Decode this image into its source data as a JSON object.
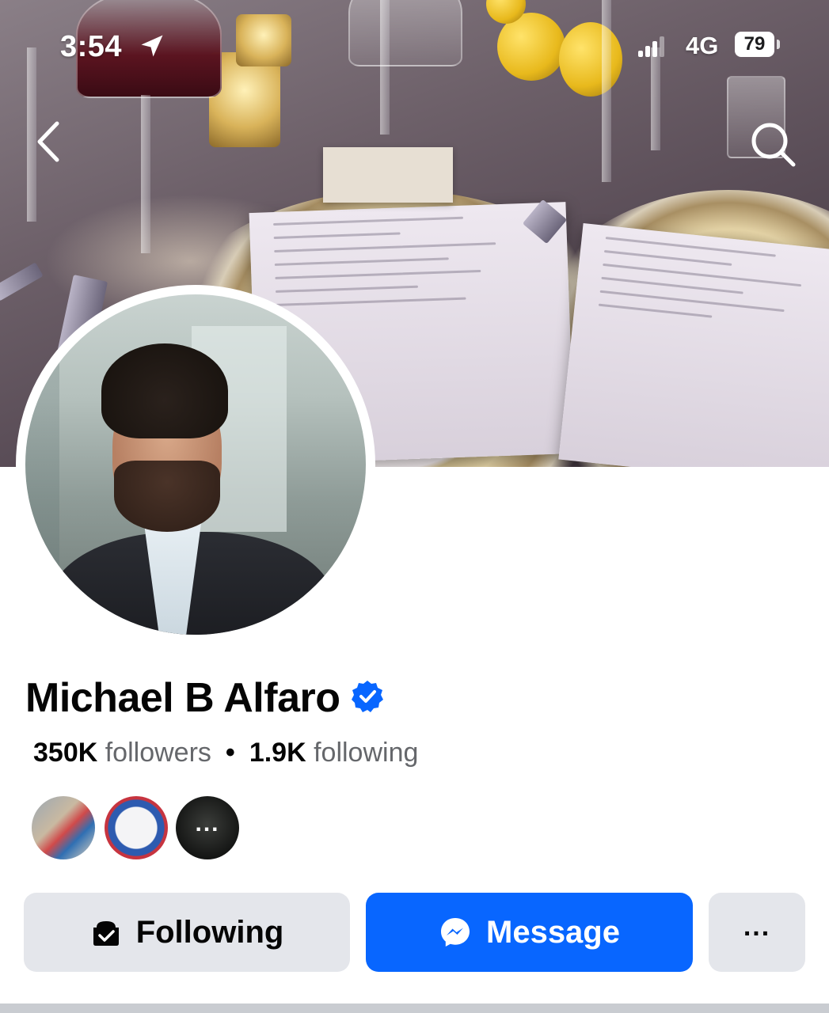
{
  "status_bar": {
    "time": "3:54",
    "network": "4G",
    "battery": "79",
    "icons": [
      "location-arrow-icon",
      "signal-icon"
    ]
  },
  "nav": {
    "back_icon": "chevron-left-icon",
    "search_icon": "search-icon"
  },
  "profile": {
    "name": "Michael B Alfaro",
    "verified": true,
    "followers_count": "350K",
    "followers_label": "followers",
    "separator": "•",
    "following_count": "1.9K",
    "following_label": "following",
    "mutual_more_label": "..."
  },
  "actions": {
    "following_label": "Following",
    "message_label": "Message",
    "more_label": "..."
  },
  "colors": {
    "accent": "#0866ff",
    "secondary_button": "#e4e6eb",
    "muted_text": "#65676b",
    "verified": "#0866ff"
  }
}
